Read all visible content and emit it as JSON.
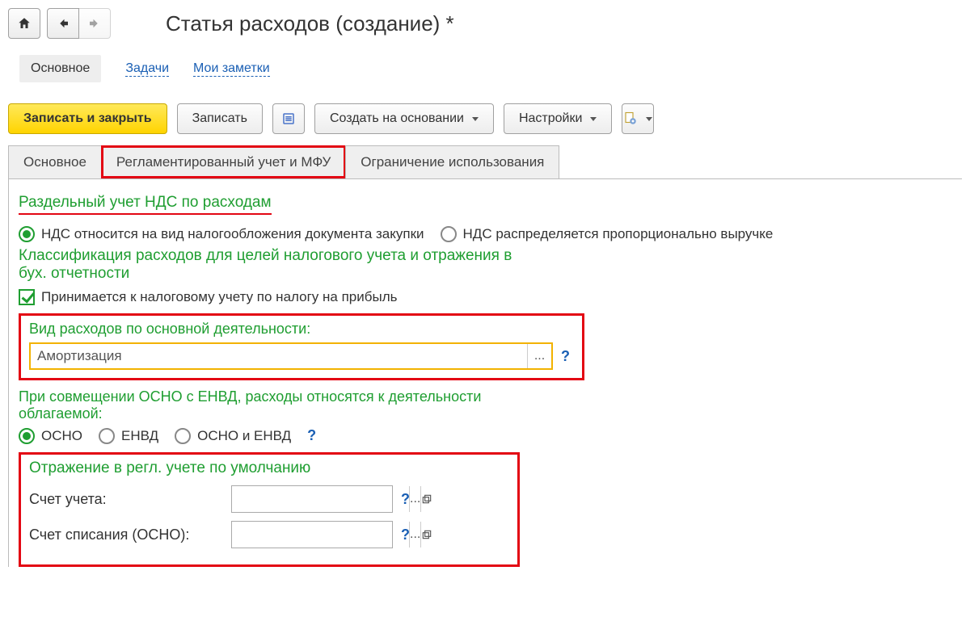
{
  "header": {
    "title": "Статья расходов (создание) *"
  },
  "sectionTabs": {
    "active": "Основное",
    "links": [
      "Задачи",
      "Мои заметки"
    ]
  },
  "toolbar": {
    "save_close": "Записать и закрыть",
    "save": "Записать",
    "create_based": "Создать на основании",
    "settings": "Настройки"
  },
  "formTabs": [
    "Основное",
    "Регламентированный учет и МФУ",
    "Ограничение использования"
  ],
  "vat": {
    "title": "Раздельный учет НДС по расходам",
    "opt1": "НДС относится на вид налогообложения документа закупки",
    "opt2": "НДС распределяется пропорционально выручке"
  },
  "tax": {
    "title": "Классификация расходов для целей налогового учета и отражения в бух. отчетности",
    "check": "Принимается к налоговому учету по налогу на прибыль"
  },
  "expType": {
    "label": "Вид расходов по основной деятельности:",
    "value": "Амортизация"
  },
  "combo": {
    "label": "При совмещении ОСНО с ЕНВД, расходы относятся к деятельности облагаемой:",
    "o1": "ОСНО",
    "o2": "ЕНВД",
    "o3": "ОСНО и ЕНВД"
  },
  "defaults": {
    "title": "Отражение в регл. учете по умолчанию",
    "acc_label": "Счет учета:",
    "writeoff_label": "Счет списания (ОСНО):"
  }
}
